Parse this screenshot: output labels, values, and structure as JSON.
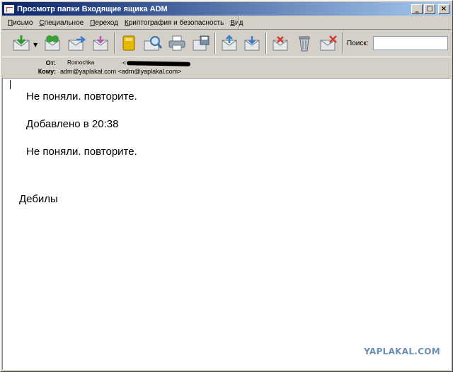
{
  "window": {
    "title": "Просмотр папки Входящие ящика ADM",
    "controls": {
      "minimize": "_",
      "maximize": "□",
      "close": "×"
    }
  },
  "menu": {
    "items": [
      {
        "label": "Письмо",
        "accel": "П"
      },
      {
        "label": "Специальное",
        "accel": "С"
      },
      {
        "label": "Переход",
        "accel": "П"
      },
      {
        "label": "Криптография и безопасность",
        "accel": "К"
      },
      {
        "label": "Вид",
        "accel": "В"
      }
    ]
  },
  "toolbar": {
    "buttons": [
      "get-mail-icon",
      "reply-all-icon",
      "forward-icon",
      "new-message-icon",
      "address-book-icon",
      "find-icon",
      "print-icon",
      "save-icon",
      "previous-message-icon",
      "next-message-icon",
      "mark-icon",
      "trash-icon",
      "delete-icon"
    ],
    "search_label": "Поиск:",
    "search_value": ""
  },
  "headers": {
    "from_label": "От:",
    "from_name": "Romochka",
    "from_email_prefix": "<",
    "to_label": "Кому:",
    "to_value": "adm@yaplakal.com <adm@yaplakal.com>"
  },
  "message": {
    "lines": [
      "Не поняли. повторите.",
      "Добавлено в 20:38",
      "Не поняли. повторите.",
      "Дебилы"
    ]
  },
  "watermark": "YAPLAKAL.COM",
  "colors": {
    "titlebar_start": "#0a246a",
    "titlebar_end": "#a6caf0",
    "chrome": "#d4d0c8",
    "watermark": "#6a8fb4"
  }
}
